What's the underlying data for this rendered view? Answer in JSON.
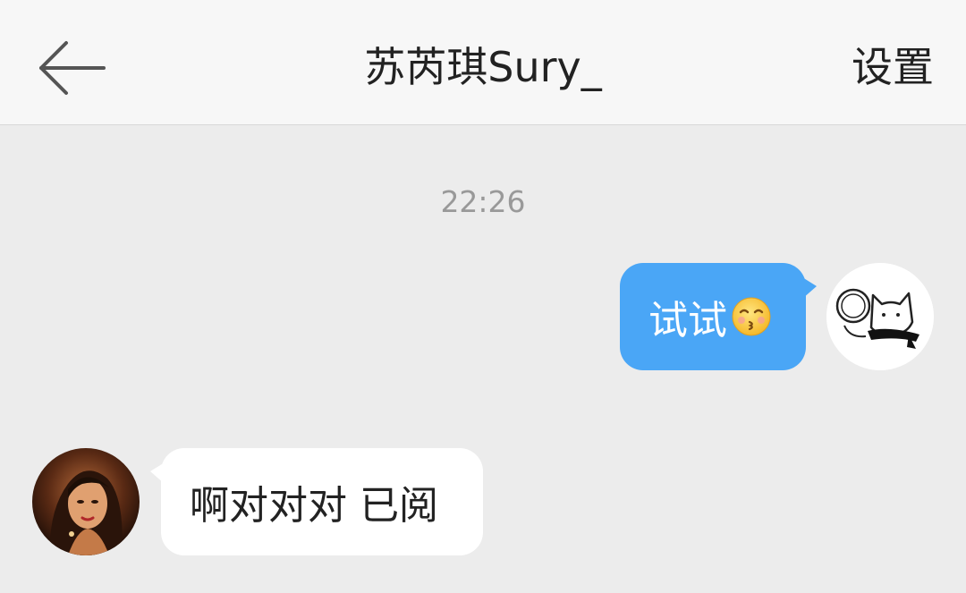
{
  "header": {
    "back_icon": "arrow-left-icon",
    "title": "苏芮琪Sury_",
    "settings_label": "设置"
  },
  "chat": {
    "timestamp": "22:26",
    "messages": [
      {
        "direction": "outgoing",
        "text": "试试",
        "emoji": "kissing-smiling-face-emoji",
        "avatar": "cartoon-cat-avatar"
      },
      {
        "direction": "incoming",
        "text": "啊对对对 已阅",
        "avatar": "user-photo-avatar"
      }
    ]
  },
  "colors": {
    "header_bg": "#f7f7f7",
    "chat_bg": "#ececec",
    "outgoing_bubble": "#4aa6f6",
    "incoming_bubble": "#ffffff",
    "timestamp_text": "#999999"
  }
}
